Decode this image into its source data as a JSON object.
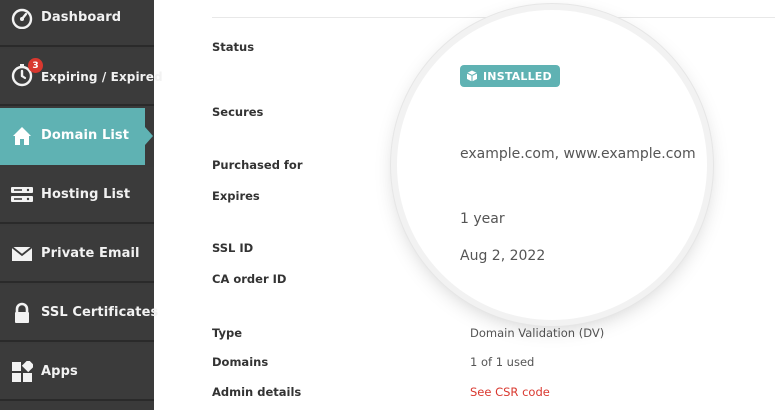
{
  "sidebar": {
    "items": [
      {
        "label": "Dashboard",
        "icon": "dashboard-gauge-icon"
      },
      {
        "label": "Expiring / Expired",
        "icon": "stopwatch-icon",
        "badge": "3"
      },
      {
        "label": "Domain List",
        "icon": "home-icon",
        "active": true
      },
      {
        "label": "Hosting List",
        "icon": "server-icon"
      },
      {
        "label": "Private Email",
        "icon": "envelope-icon"
      },
      {
        "label": "SSL Certificates",
        "icon": "lock-icon"
      },
      {
        "label": "Apps",
        "icon": "apps-grid-icon"
      }
    ],
    "accent": "#5fb2b3",
    "background": "#3b3b3b"
  },
  "details": {
    "labels": {
      "status": "Status",
      "secures": "Secures",
      "purchased_for": "Purchased for",
      "expires": "Expires",
      "ssl_id": "SSL ID",
      "ca_order_id": "CA order ID",
      "type": "Type",
      "domains": "Domains",
      "admin_details": "Admin details"
    },
    "values": {
      "type": "Domain Validation (DV)",
      "domains": "1 of 1 used",
      "admin_details": "See CSR code"
    }
  },
  "lens": {
    "status_badge": "INSTALLED",
    "secures": "example.com, www.example.com",
    "purchased_for": "1 year",
    "expires": "Aug 2, 2022"
  },
  "colors": {
    "link": "#d9382f",
    "badge": "#d9382f"
  }
}
